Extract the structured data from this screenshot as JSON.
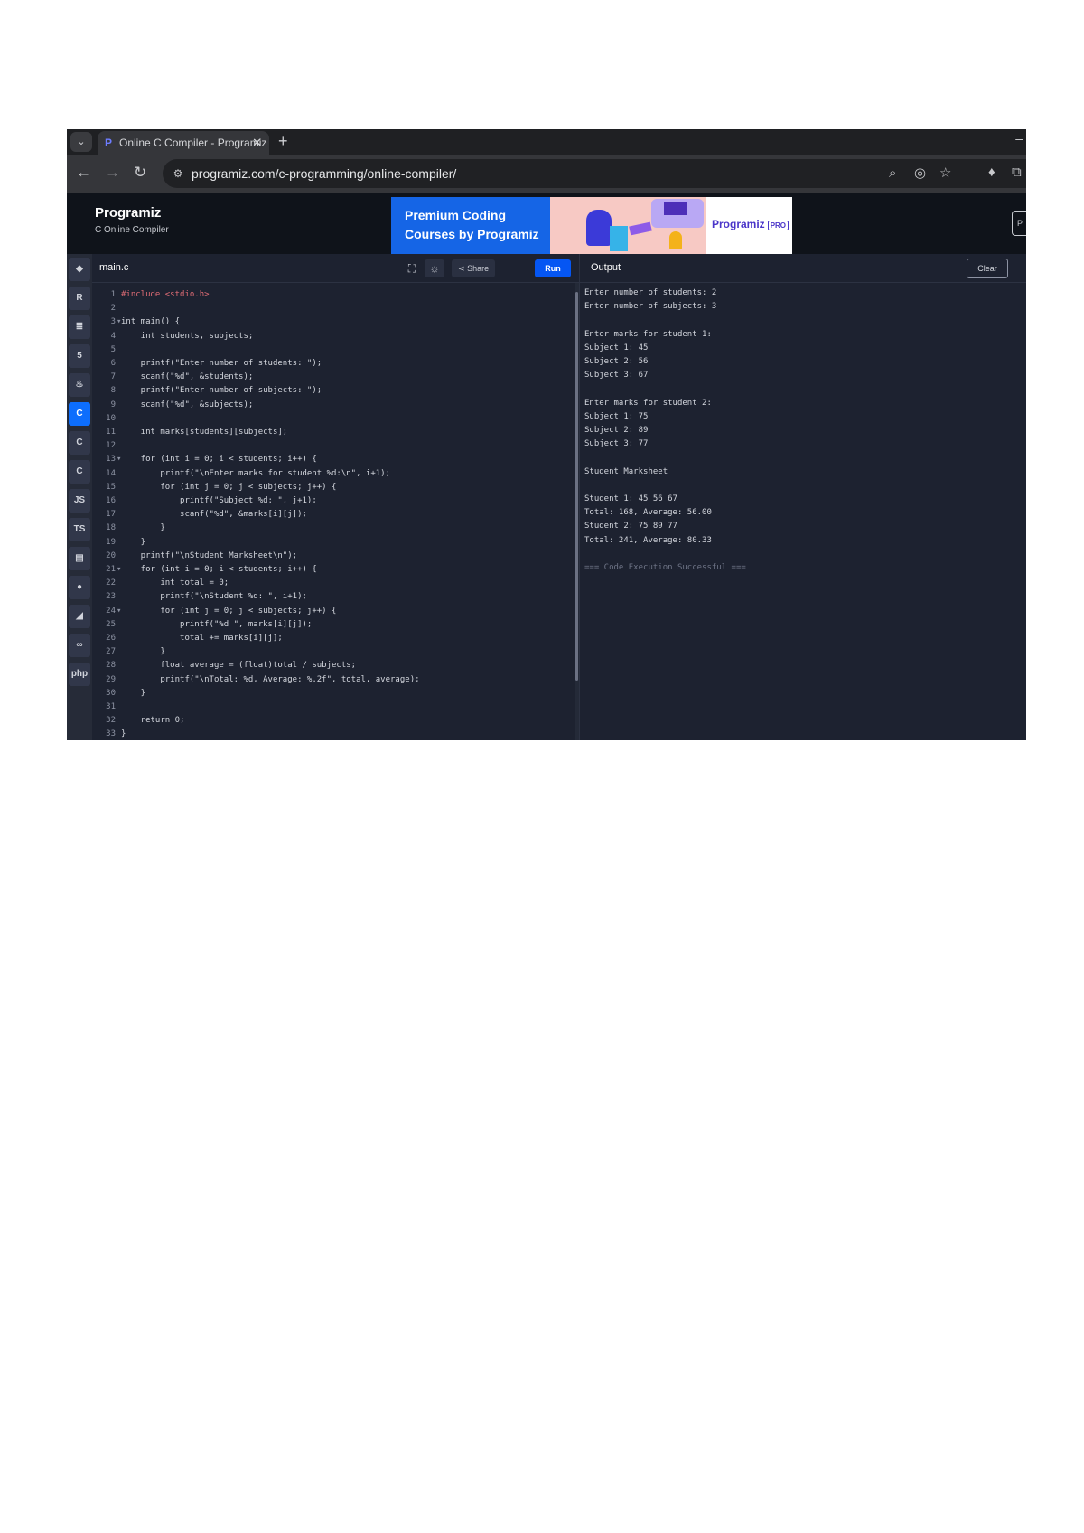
{
  "browser": {
    "tab_title": "Online C Compiler - Programiz",
    "tab_close": "✕",
    "new_tab": "+",
    "url": "programiz.com/c-programming/online-compiler/",
    "window_min": "–"
  },
  "site": {
    "logo": "Programiz",
    "subtitle": "C Online Compiler",
    "banner_line1": "Premium Coding",
    "banner_line2": "Courses by Programiz",
    "banner_brand": "Programiz",
    "banner_badge": "PRO"
  },
  "rail": {
    "items": [
      {
        "icon": "python-icon",
        "glyph": "◆",
        "active": false
      },
      {
        "icon": "r-icon",
        "glyph": "R",
        "active": false
      },
      {
        "icon": "sql-icon",
        "glyph": "≣",
        "active": false
      },
      {
        "icon": "html-icon",
        "glyph": "5",
        "active": false
      },
      {
        "icon": "java-icon",
        "glyph": "♨",
        "active": false
      },
      {
        "icon": "c-icon",
        "glyph": "C",
        "active": true
      },
      {
        "icon": "cpp-icon",
        "glyph": "C",
        "active": false
      },
      {
        "icon": "csharp-icon",
        "glyph": "C",
        "active": false
      },
      {
        "icon": "js-icon",
        "glyph": "JS",
        "active": false
      },
      {
        "icon": "ts-icon",
        "glyph": "TS",
        "active": false
      },
      {
        "icon": "go-icon",
        "glyph": "▤",
        "active": false
      },
      {
        "icon": "php-icon",
        "glyph": "●",
        "active": false
      },
      {
        "icon": "swift-icon",
        "glyph": "◢",
        "active": false
      },
      {
        "icon": "rust-icon",
        "glyph": "∞",
        "active": false
      },
      {
        "icon": "php-lang-icon",
        "glyph": "php",
        "active": false
      }
    ]
  },
  "editor": {
    "file_name": "main.c",
    "share_label": "Share",
    "run_label": "Run",
    "lines": [
      {
        "n": "1",
        "fold": "",
        "text": "#include <stdio.h>",
        "color": "#e06c75"
      },
      {
        "n": "2",
        "fold": "",
        "text": "",
        "color": "#d4d7de"
      },
      {
        "n": "3",
        "fold": "▾",
        "text": "int main() {",
        "color": "#d4d7de"
      },
      {
        "n": "4",
        "fold": "",
        "text": "    int students, subjects;",
        "color": "#d4d7de"
      },
      {
        "n": "5",
        "fold": "",
        "text": "",
        "color": "#d4d7de"
      },
      {
        "n": "6",
        "fold": "",
        "text": "    printf(\"Enter number of students: \");",
        "color": "#d4d7de"
      },
      {
        "n": "7",
        "fold": "",
        "text": "    scanf(\"%d\", &students);",
        "color": "#d4d7de"
      },
      {
        "n": "8",
        "fold": "",
        "text": "    printf(\"Enter number of subjects: \");",
        "color": "#d4d7de"
      },
      {
        "n": "9",
        "fold": "",
        "text": "    scanf(\"%d\", &subjects);",
        "color": "#d4d7de"
      },
      {
        "n": "10",
        "fold": "",
        "text": "",
        "color": "#d4d7de"
      },
      {
        "n": "11",
        "fold": "",
        "text": "    int marks[students][subjects];",
        "color": "#d4d7de"
      },
      {
        "n": "12",
        "fold": "",
        "text": "",
        "color": "#d4d7de"
      },
      {
        "n": "13",
        "fold": "▾",
        "text": "    for (int i = 0; i < students; i++) {",
        "color": "#d4d7de"
      },
      {
        "n": "14",
        "fold": "",
        "text": "        printf(\"\\nEnter marks for student %d:\\n\", i+1);",
        "color": "#d4d7de"
      },
      {
        "n": "15",
        "fold": "",
        "text": "        for (int j = 0; j < subjects; j++) {",
        "color": "#d4d7de"
      },
      {
        "n": "16",
        "fold": "",
        "text": "            printf(\"Subject %d: \", j+1);",
        "color": "#d4d7de"
      },
      {
        "n": "17",
        "fold": "",
        "text": "            scanf(\"%d\", &marks[i][j]);",
        "color": "#d4d7de"
      },
      {
        "n": "18",
        "fold": "",
        "text": "        }",
        "color": "#d4d7de"
      },
      {
        "n": "19",
        "fold": "",
        "text": "    }",
        "color": "#d4d7de"
      },
      {
        "n": "20",
        "fold": "",
        "text": "    printf(\"\\nStudent Marksheet\\n\");",
        "color": "#d4d7de"
      },
      {
        "n": "21",
        "fold": "▾",
        "text": "    for (int i = 0; i < students; i++) {",
        "color": "#d4d7de"
      },
      {
        "n": "22",
        "fold": "",
        "text": "        int total = 0;",
        "color": "#d4d7de"
      },
      {
        "n": "23",
        "fold": "",
        "text": "        printf(\"\\nStudent %d: \", i+1);",
        "color": "#d4d7de"
      },
      {
        "n": "24",
        "fold": "▾",
        "text": "        for (int j = 0; j < subjects; j++) {",
        "color": "#d4d7de"
      },
      {
        "n": "25",
        "fold": "",
        "text": "            printf(\"%d \", marks[i][j]);",
        "color": "#d4d7de"
      },
      {
        "n": "26",
        "fold": "",
        "text": "            total += marks[i][j];",
        "color": "#d4d7de"
      },
      {
        "n": "27",
        "fold": "",
        "text": "        }",
        "color": "#d4d7de"
      },
      {
        "n": "28",
        "fold": "",
        "text": "        float average = (float)total / subjects;",
        "color": "#d4d7de"
      },
      {
        "n": "29",
        "fold": "",
        "text": "        printf(\"\\nTotal: %d, Average: %.2f\", total, average);",
        "color": "#d4d7de"
      },
      {
        "n": "30",
        "fold": "",
        "text": "    }",
        "color": "#d4d7de"
      },
      {
        "n": "31",
        "fold": "",
        "text": "",
        "color": "#d4d7de"
      },
      {
        "n": "32",
        "fold": "",
        "text": "    return 0;",
        "color": "#d4d7de"
      },
      {
        "n": "33",
        "fold": "",
        "text": "}",
        "color": "#d4d7de"
      }
    ]
  },
  "output": {
    "title": "Output",
    "clear_label": "Clear",
    "lines": [
      {
        "text": "Enter number of students: 2",
        "dim": false
      },
      {
        "text": "Enter number of subjects: 3",
        "dim": false
      },
      {
        "text": "",
        "dim": false
      },
      {
        "text": "Enter marks for student 1:",
        "dim": false
      },
      {
        "text": "Subject 1: 45",
        "dim": false
      },
      {
        "text": "Subject 2: 56",
        "dim": false
      },
      {
        "text": "Subject 3: 67",
        "dim": false
      },
      {
        "text": "",
        "dim": false
      },
      {
        "text": "Enter marks for student 2:",
        "dim": false
      },
      {
        "text": "Subject 1: 75",
        "dim": false
      },
      {
        "text": "Subject 2: 89",
        "dim": false
      },
      {
        "text": "Subject 3: 77",
        "dim": false
      },
      {
        "text": "",
        "dim": false
      },
      {
        "text": "Student Marksheet",
        "dim": false
      },
      {
        "text": "",
        "dim": false
      },
      {
        "text": "Student 1: 45 56 67",
        "dim": false
      },
      {
        "text": "Total: 168, Average: 56.00",
        "dim": false
      },
      {
        "text": "Student 2: 75 89 77",
        "dim": false
      },
      {
        "text": "Total: 241, Average: 80.33",
        "dim": false
      },
      {
        "text": "",
        "dim": false
      },
      {
        "text": "=== Code Execution Successful ===",
        "dim": true
      }
    ]
  },
  "colors": {
    "accent": "#0556f3",
    "editor_bg": "#1d2230",
    "rail_active": "#0d6efd"
  }
}
